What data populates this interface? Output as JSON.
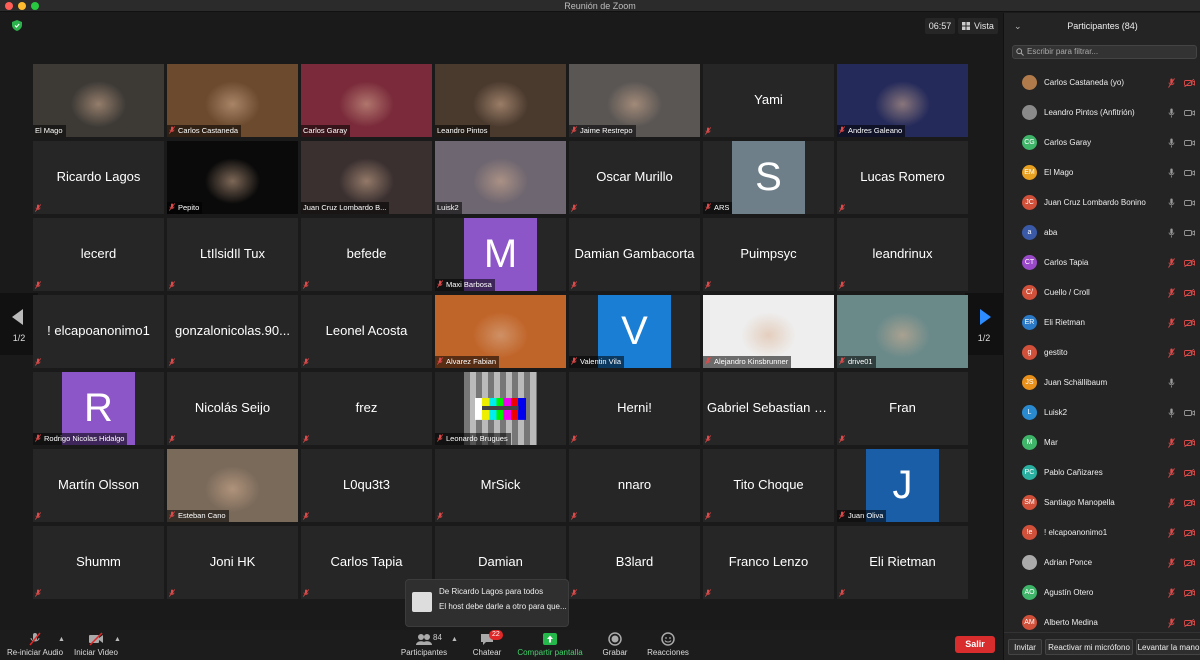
{
  "window": {
    "title": "Reunión de Zoom"
  },
  "meeting": {
    "timer": "06:57",
    "view_label": "Vista",
    "pager_left_label": "1/2",
    "pager_right_label": "1/2"
  },
  "tiles": [
    {
      "name": "El Mago",
      "kind": "video",
      "muted": false,
      "bg": "#3d3a36"
    },
    {
      "name": "Carlos Castaneda",
      "kind": "video",
      "muted": true,
      "bg": "#6b4a2e"
    },
    {
      "name": "Carlos Garay",
      "kind": "video",
      "muted": false,
      "bg": "#7a2a3a"
    },
    {
      "name": "Leandro Pintos",
      "kind": "video",
      "muted": false,
      "bg": "#4a3a2e"
    },
    {
      "name": "Jaime Restrepo",
      "kind": "video",
      "muted": true,
      "bg": "#5a5654"
    },
    {
      "name": "Yami",
      "kind": "name",
      "muted": true
    },
    {
      "name": "Andres Galeano",
      "kind": "video",
      "muted": true,
      "bg": "#242a5a"
    },
    {
      "name": "Ricardo Lagos",
      "kind": "name",
      "muted": true
    },
    {
      "name": "Pepito",
      "kind": "video",
      "muted": true,
      "bg": "#0a0a0a"
    },
    {
      "name": "Juan Cruz Lombardo B...",
      "kind": "video",
      "muted": false,
      "bg": "#3a3030",
      "active": true
    },
    {
      "name": "Luisk2",
      "kind": "video",
      "muted": false,
      "bg": "#6e6670"
    },
    {
      "name": "Oscar Murillo",
      "kind": "name",
      "muted": true
    },
    {
      "name": "ARS",
      "kind": "letter",
      "letter": "S",
      "muted": true,
      "color": "#6e7f8a"
    },
    {
      "name": "Lucas Romero",
      "kind": "name",
      "muted": true
    },
    {
      "name": "lecerd",
      "kind": "name",
      "muted": true
    },
    {
      "name": "LtIlsidIl Tux",
      "kind": "name",
      "muted": true
    },
    {
      "name": "befede",
      "kind": "name",
      "muted": true
    },
    {
      "name": "Maxi Barbosa",
      "kind": "letter",
      "letter": "M",
      "muted": true,
      "color": "#8c55c8"
    },
    {
      "name": "Damian Gambacorta",
      "kind": "name",
      "muted": true
    },
    {
      "name": "Puimpsyc",
      "kind": "name",
      "muted": true
    },
    {
      "name": "leandrinux",
      "kind": "name",
      "muted": true
    },
    {
      "name": "! elcapoanonimo1",
      "kind": "name",
      "muted": true
    },
    {
      "name": "gonzalonicolas.90...",
      "kind": "name",
      "muted": true
    },
    {
      "name": "Leonel Acosta",
      "kind": "name",
      "muted": true
    },
    {
      "name": "Alvarez Fabian",
      "kind": "video",
      "muted": true,
      "bg": "#c0652a"
    },
    {
      "name": "Valentin Vila",
      "kind": "letter",
      "letter": "V",
      "muted": true,
      "color": "#1a7ed4"
    },
    {
      "name": "Alejandro Kinsbrunner",
      "kind": "video",
      "muted": true,
      "bg": "#eeeeee"
    },
    {
      "name": "drive01",
      "kind": "video",
      "muted": true,
      "bg": "#6a8a8a"
    },
    {
      "name": "Rodrigo Nicolas Hidalgo",
      "kind": "letter",
      "letter": "R",
      "muted": true,
      "color": "#8c55c8"
    },
    {
      "name": "Nicolás Seijo",
      "kind": "name",
      "muted": true
    },
    {
      "name": "frez",
      "kind": "name",
      "muted": true
    },
    {
      "name": "Leonardo Brugues",
      "kind": "testcard",
      "muted": true
    },
    {
      "name": "Herni!",
      "kind": "name",
      "muted": true
    },
    {
      "name": "Gabriel Sebastian Fi...",
      "kind": "name",
      "muted": true
    },
    {
      "name": "Fran",
      "kind": "name",
      "muted": true
    },
    {
      "name": "Martín Olsson",
      "kind": "name",
      "muted": true
    },
    {
      "name": "Esteban Cano",
      "kind": "video",
      "muted": true,
      "bg": "#7a6a5a"
    },
    {
      "name": "L0qu3t3",
      "kind": "name",
      "muted": true
    },
    {
      "name": "MrSick",
      "kind": "name",
      "muted": true
    },
    {
      "name": "nnaro",
      "kind": "name",
      "muted": true
    },
    {
      "name": "Tito Choque",
      "kind": "name",
      "muted": true
    },
    {
      "name": "Juan Oliva",
      "kind": "letter",
      "letter": "J",
      "muted": true,
      "color": "#1a5ea8"
    },
    {
      "name": "Shumm",
      "kind": "name",
      "muted": true
    },
    {
      "name": "Joni HK",
      "kind": "name",
      "muted": true
    },
    {
      "name": "Carlos Tapia",
      "kind": "name",
      "muted": true
    },
    {
      "name": "Damian",
      "kind": "name",
      "muted": true
    },
    {
      "name": "B3lard",
      "kind": "name",
      "muted": true
    },
    {
      "name": "Franco Lenzo",
      "kind": "name",
      "muted": true
    },
    {
      "name": "Eli Rietman",
      "kind": "name",
      "muted": true
    }
  ],
  "chat_toast": {
    "from": "De Ricardo Lagos para todos",
    "message": "El host debe darle a otro para que..."
  },
  "toolbar": {
    "audio_label": "Re-iniciar Audio",
    "video_label": "Iniciar Video",
    "participants_label": "Participantes",
    "participants_count": "84",
    "chat_label": "Chatear",
    "chat_badge": "22",
    "share_label": "Compartir pantalla",
    "record_label": "Grabar",
    "reactions_label": "Reacciones",
    "leave_label": "Salir"
  },
  "panel": {
    "title": "Participantes (84)",
    "search_placeholder": "Escribir para filtrar...",
    "participants": [
      {
        "name": "Carlos Castaneda (yo)",
        "initials": "",
        "color": "#b07a4a",
        "mic": "muted",
        "cam": "off"
      },
      {
        "name": "Leandro Pintos (Anfitrión)",
        "initials": "",
        "color": "#8a8a8a",
        "mic": "on",
        "cam": "on"
      },
      {
        "name": "Carlos Garay",
        "initials": "CG",
        "color": "#3fb56a",
        "mic": "on",
        "cam": "on"
      },
      {
        "name": "El Mago",
        "initials": "EM",
        "color": "#e8a020",
        "mic": "on",
        "cam": "on"
      },
      {
        "name": "Juan Cruz Lombardo Bonino",
        "initials": "JC",
        "color": "#d0503a",
        "mic": "on",
        "cam": "on"
      },
      {
        "name": "aba",
        "initials": "a",
        "color": "#3a5aa8",
        "mic": "on",
        "cam": "on"
      },
      {
        "name": "Carlos Tapia",
        "initials": "CT",
        "color": "#9a4ac8",
        "mic": "muted",
        "cam": "off"
      },
      {
        "name": "Cuello / Croll",
        "initials": "C/",
        "color": "#d0503a",
        "mic": "muted",
        "cam": "off"
      },
      {
        "name": "Eli Rietman",
        "initials": "ER",
        "color": "#2a7ac8",
        "mic": "muted",
        "cam": "off"
      },
      {
        "name": "gestito",
        "initials": "g",
        "color": "#d0503a",
        "mic": "muted",
        "cam": "off"
      },
      {
        "name": "Juan Schällibaum",
        "initials": "JS",
        "color": "#e8901a",
        "mic": "on",
        "cam": "none"
      },
      {
        "name": "Luisk2",
        "initials": "L",
        "color": "#2a8ad0",
        "mic": "on",
        "cam": "on"
      },
      {
        "name": "Mar",
        "initials": "M",
        "color": "#3fb56a",
        "mic": "muted",
        "cam": "off"
      },
      {
        "name": "Pablo Cañizares",
        "initials": "PC",
        "color": "#2ab0a0",
        "mic": "muted",
        "cam": "off"
      },
      {
        "name": "Santiago Manopella",
        "initials": "SM",
        "color": "#d0503a",
        "mic": "muted",
        "cam": "off"
      },
      {
        "name": "! elcapoanonimo1",
        "initials": "!e",
        "color": "#d0503a",
        "mic": "muted",
        "cam": "off"
      },
      {
        "name": "Adrian Ponce",
        "initials": "",
        "color": "#aaaaaa",
        "mic": "muted",
        "cam": "off"
      },
      {
        "name": "Agustín Otero",
        "initials": "AO",
        "color": "#3fb56a",
        "mic": "muted",
        "cam": "off"
      },
      {
        "name": "Alberto Medina",
        "initials": "AM",
        "color": "#d0503a",
        "mic": "muted",
        "cam": "off"
      }
    ],
    "footer": {
      "invite_label": "Invitar",
      "unmute_label": "Reactivar mi micrófono",
      "raise_hand_label": "Levantar la mano"
    }
  }
}
